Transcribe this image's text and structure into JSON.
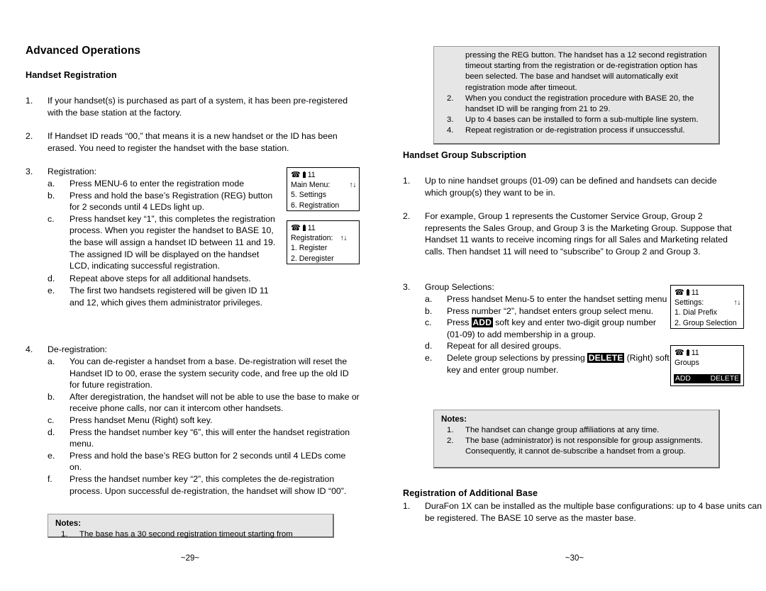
{
  "pages": {
    "left": {
      "folio": "~29~",
      "section_title": "Advanced Operations",
      "sub_title": "Handset Registration",
      "items": [
        {
          "marker": "1.",
          "text": "If your handset(s) is purchased as part of a system, it has been pre-registered with the base station at the factory."
        },
        {
          "marker": "2.",
          "text": "If Handset ID reads “00,” that means it is a new handset or the ID has been erased. You need to register the handset with the base station."
        },
        {
          "marker": "3.",
          "text": "Registration:"
        },
        {
          "marker": "4.",
          "text": "De-registration:"
        }
      ],
      "registration_steps": [
        {
          "marker": "a.",
          "text": "Press MENU-6 to enter the registration mode"
        },
        {
          "marker": "b.",
          "text": "Press and hold the base’s Registration (REG) button for 2 seconds until 4 LEDs light up."
        },
        {
          "marker": "c.",
          "text": "Press handset key “1”, this completes the registration process.  When you register the handset to BASE 10, the base will assign a handset ID between 11 and 19.  The assigned ID will be displayed on the handset LCD, indicating successful registration."
        },
        {
          "marker": "d.",
          "text": "Repeat above steps for all additional handsets."
        },
        {
          "marker": "e.",
          "text": "The first two handsets registered will be given ID 11 and 12, which gives them administrator privileges."
        }
      ],
      "deregistration_steps": [
        {
          "marker": "a.",
          "text": "You can de-register a handset from a base.  De-registration will reset the Handset ID to 00, erase the system security code, and free up the old ID for future registration."
        },
        {
          "marker": "b.",
          "text": "After deregistration, the handset will not be able to use the base to make or receive phone calls, nor can it intercom other handsets."
        },
        {
          "marker": "c.",
          "text": "Press handset Menu (Right) soft key."
        },
        {
          "marker": "d.",
          "text": "Press the handset number key “6”, this will enter the handset registration menu."
        },
        {
          "marker": "e.",
          "text": "Press and hold the base’s REG button for 2 seconds until 4 LEDs come on."
        },
        {
          "marker": "f.",
          "text": "Press the handset number key “2”, this completes the de-registration process.  Upon successful de-registration, the handset will show ID “00”."
        }
      ],
      "lcd_main_menu": {
        "handset_id": "11",
        "title": "Main Menu:",
        "arrows": "↑↓",
        "line1": "5. Settings",
        "line2": "6. Registration"
      },
      "lcd_registration": {
        "handset_id": "11",
        "title": "Registration:",
        "arrows": "↑↓",
        "line1": "1. Register",
        "line2": "2. Deregister"
      },
      "notes": {
        "title": "Notes:",
        "items": [
          {
            "marker": "1.",
            "text": "The base has a 30 second registration timeout starting from"
          }
        ]
      }
    },
    "right": {
      "folio": "~30~",
      "notes_top": {
        "continuation": "pressing the REG button.  The handset has a 12 second registration timeout starting from the registration or de-registration option has been selected.  The base and handset will automatically exit registration mode after timeout.",
        "items": [
          {
            "marker": "2.",
            "text": "When you conduct the registration procedure with BASE 20, the handset ID will be ranging from 21 to 29."
          },
          {
            "marker": "3.",
            "text": "Up to 4 bases can be installed to form a sub-multiple line system."
          },
          {
            "marker": "4.",
            "text": "Repeat registration or de-registration process if unsuccessful."
          }
        ]
      },
      "sub_title": "Handset Group Subscription",
      "items": [
        {
          "marker": "1.",
          "text": "Up to nine handset groups (01-09) can be defined and handsets can decide which group(s) they want to be in."
        },
        {
          "marker": "2.",
          "text": "For example, Group 1 represents the Customer Service Group, Group 2 represents the Sales Group, and Group 3 is the Marketing Group.  Suppose that Handset 11 wants to receive incoming rings for all Sales and Marketing related calls.  Then handset 11 will need to “subscribe” to Group 2 and Group 3."
        },
        {
          "marker": "3.",
          "text": "Group Selections:"
        }
      ],
      "group_steps": [
        {
          "marker": "a.",
          "text": "Press handset Menu-5 to enter the handset setting menu"
        },
        {
          "marker": "b.",
          "text": "Press number “2”, handset enters group select menu."
        },
        {
          "marker": "c",
          "pre": "Press ",
          "keycap": "ADD",
          "post": " soft key and enter two-digit group number (01-09) to add membership in a group.",
          "marker_text": "c."
        },
        {
          "marker": "d.",
          "text": "Repeat for all desired groups."
        },
        {
          "marker": "e",
          "pre": "Delete group selections by pressing ",
          "keycap": "DELETE",
          "post": " (Right) soft key and enter group number.",
          "marker_text": "e."
        }
      ],
      "lcd_settings": {
        "handset_id": "11",
        "title": "Settings:",
        "arrows": "↑↓",
        "line1": "1. Dial Prefix",
        "line2": "2. Group Selection"
      },
      "lcd_groups": {
        "handset_id": "11",
        "title": "Groups",
        "softkey_left": "ADD",
        "softkey_right": "DELETE"
      },
      "notes_bottom": {
        "title": "Notes:",
        "items": [
          {
            "marker": "1.",
            "text": "The handset can change group affiliations at any time."
          },
          {
            "marker": "2.",
            "text": "The base (administrator) is not responsible for group assignments.  Consequently, it cannot de-subscribe a handset from a group."
          }
        ]
      },
      "closing_sub_title": "Registration of Additional Base",
      "closing_items": [
        {
          "marker": "1.",
          "text": "DuraFon 1X can be installed as the multiple base configurations: up to 4 base units can be registered. The BASE 10 serve as the master base."
        }
      ]
    }
  }
}
